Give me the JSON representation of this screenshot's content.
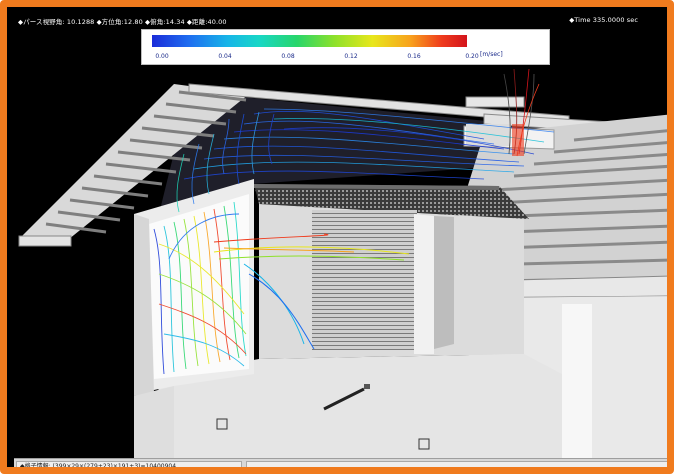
{
  "header": {
    "left_text": "◆パース視野角: 10.1288 ◆方位角:12.80 ◆俯角:14.34 ◆距離:40.00",
    "right_text": "◆Time 335.0000 sec"
  },
  "legend": {
    "ticks": [
      "0.00",
      "0.04",
      "0.08",
      "0.12",
      "0.16",
      "0.20"
    ],
    "unit": "[m/sec]",
    "colors": [
      "#1b2cd9",
      "#1f6ff0",
      "#17b5e8",
      "#18d7c6",
      "#27d66b",
      "#8ee12a",
      "#e8e71c",
      "#f8a21d",
      "#ef3b1d",
      "#d3141c"
    ]
  },
  "status": {
    "grid_info": "◆格子情報: (399×29×(279+23)×191+3)=10400904",
    "blank": ""
  },
  "frame_color": "#f07b1e"
}
